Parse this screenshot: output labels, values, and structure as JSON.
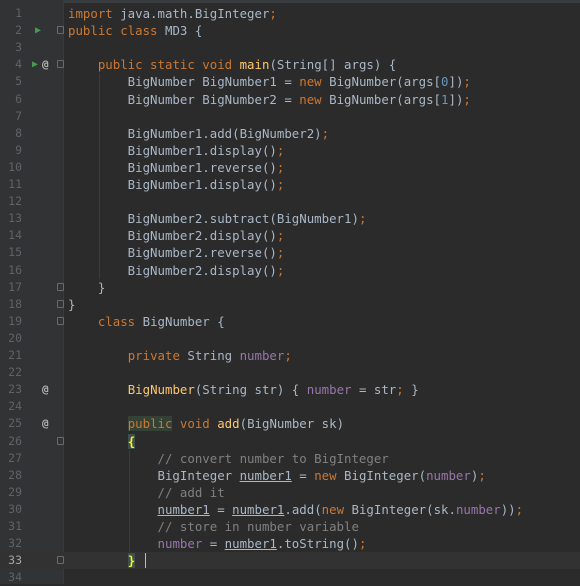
{
  "lines": [
    {
      "n": "1",
      "tokens": [
        [
          "kw",
          "import "
        ],
        [
          "p",
          "java.math.BigInteger"
        ],
        [
          "kw",
          ";"
        ]
      ]
    },
    {
      "n": "2",
      "tokens": [
        [
          "kw",
          "public class "
        ],
        [
          "p",
          "MD3 {"
        ]
      ]
    },
    {
      "n": "3",
      "tokens": []
    },
    {
      "n": "4",
      "tokens": [
        [
          "p",
          "    "
        ],
        [
          "kw",
          "public static void "
        ],
        [
          "fn",
          "main"
        ],
        [
          "p",
          "(String[] args) {"
        ]
      ]
    },
    {
      "n": "5",
      "tokens": [
        [
          "p",
          "        BigNumber BigNumber1 = "
        ],
        [
          "kw",
          "new "
        ],
        [
          "p",
          "BigNumber(args["
        ],
        [
          "num",
          "0"
        ],
        [
          "p",
          "])"
        ],
        [
          "kw",
          ";"
        ]
      ]
    },
    {
      "n": "6",
      "tokens": [
        [
          "p",
          "        BigNumber BigNumber2 = "
        ],
        [
          "kw",
          "new "
        ],
        [
          "p",
          "BigNumber(args["
        ],
        [
          "num",
          "1"
        ],
        [
          "p",
          "])"
        ],
        [
          "kw",
          ";"
        ]
      ]
    },
    {
      "n": "7",
      "tokens": []
    },
    {
      "n": "8",
      "tokens": [
        [
          "p",
          "        BigNumber1.add(BigNumber2)"
        ],
        [
          "kw",
          ";"
        ]
      ]
    },
    {
      "n": "9",
      "tokens": [
        [
          "p",
          "        BigNumber1.display()"
        ],
        [
          "kw",
          ";"
        ]
      ]
    },
    {
      "n": "10",
      "tokens": [
        [
          "p",
          "        BigNumber1.reverse()"
        ],
        [
          "kw",
          ";"
        ]
      ]
    },
    {
      "n": "11",
      "tokens": [
        [
          "p",
          "        BigNumber1.display()"
        ],
        [
          "kw",
          ";"
        ]
      ]
    },
    {
      "n": "12",
      "tokens": []
    },
    {
      "n": "13",
      "tokens": [
        [
          "p",
          "        BigNumber2.subtract(BigNumber1)"
        ],
        [
          "kw",
          ";"
        ]
      ]
    },
    {
      "n": "14",
      "tokens": [
        [
          "p",
          "        BigNumber2.display()"
        ],
        [
          "kw",
          ";"
        ]
      ]
    },
    {
      "n": "15",
      "tokens": [
        [
          "p",
          "        BigNumber2.reverse()"
        ],
        [
          "kw",
          ";"
        ]
      ]
    },
    {
      "n": "16",
      "tokens": [
        [
          "p",
          "        BigNumber2.display()"
        ],
        [
          "kw",
          ";"
        ]
      ]
    },
    {
      "n": "17",
      "tokens": [
        [
          "p",
          "    }"
        ]
      ]
    },
    {
      "n": "18",
      "tokens": [
        [
          "p",
          "}"
        ]
      ]
    },
    {
      "n": "19",
      "tokens": [
        [
          "p",
          "    "
        ],
        [
          "kw",
          "class "
        ],
        [
          "p",
          "BigNumber {"
        ]
      ]
    },
    {
      "n": "20",
      "tokens": []
    },
    {
      "n": "21",
      "tokens": [
        [
          "p",
          "        "
        ],
        [
          "kw",
          "private "
        ],
        [
          "p",
          "String "
        ],
        [
          "field",
          "number"
        ],
        [
          "kw",
          ";"
        ]
      ]
    },
    {
      "n": "22",
      "tokens": []
    },
    {
      "n": "23",
      "tokens": [
        [
          "p",
          "        "
        ],
        [
          "fn",
          "BigNumber"
        ],
        [
          "p",
          "(String str) { "
        ],
        [
          "field",
          "number "
        ],
        [
          "p",
          "= str"
        ],
        [
          "kw",
          "; "
        ],
        [
          "p",
          "}"
        ]
      ]
    },
    {
      "n": "24",
      "tokens": []
    },
    {
      "n": "25",
      "tokens": [
        [
          "p",
          "        "
        ],
        [
          "kw hl",
          "public"
        ],
        [
          "kw",
          " void "
        ],
        [
          "fn",
          "add"
        ],
        [
          "p",
          "(BigNumber sk)"
        ]
      ]
    },
    {
      "n": "26",
      "tokens": [
        [
          "p",
          "        "
        ],
        [
          "brace-hl",
          "{"
        ]
      ]
    },
    {
      "n": "27",
      "tokens": [
        [
          "cmt",
          "            // convert number to BigInteger"
        ]
      ]
    },
    {
      "n": "28",
      "tokens": [
        [
          "p",
          "            BigInteger "
        ],
        [
          "und",
          "number1"
        ],
        [
          "p",
          " = "
        ],
        [
          "kw",
          "new "
        ],
        [
          "p",
          "BigInteger("
        ],
        [
          "field",
          "number"
        ],
        [
          "p",
          ")"
        ],
        [
          "kw",
          ";"
        ]
      ]
    },
    {
      "n": "29",
      "tokens": [
        [
          "cmt",
          "            // add it"
        ]
      ]
    },
    {
      "n": "30",
      "tokens": [
        [
          "p",
          "            "
        ],
        [
          "und",
          "number1"
        ],
        [
          "p",
          " = "
        ],
        [
          "und",
          "number1"
        ],
        [
          "p",
          ".add("
        ],
        [
          "kw",
          "new "
        ],
        [
          "p",
          "BigInteger(sk."
        ],
        [
          "field",
          "number"
        ],
        [
          "p",
          "))"
        ],
        [
          "kw",
          ";"
        ]
      ]
    },
    {
      "n": "31",
      "tokens": [
        [
          "cmt",
          "            // store in number variable"
        ]
      ]
    },
    {
      "n": "32",
      "tokens": [
        [
          "p",
          "            "
        ],
        [
          "field",
          "number "
        ],
        [
          "p",
          "= "
        ],
        [
          "und",
          "number1"
        ],
        [
          "p",
          ".toString()"
        ],
        [
          "kw",
          ";"
        ]
      ]
    },
    {
      "n": "33",
      "tokens": [
        [
          "p",
          "        "
        ],
        [
          "brace-hl",
          "}"
        ]
      ]
    },
    {
      "n": "34",
      "tokens": []
    }
  ],
  "gutter_icons": {
    "2": [
      "run"
    ],
    "4": [
      "run",
      "at"
    ],
    "23": [
      "at"
    ],
    "25": [
      "at"
    ]
  },
  "fold_markers": [
    "2",
    "4",
    "17",
    "18",
    "19",
    "26",
    "33"
  ],
  "current_line": "33",
  "colors": {
    "background": "#2b2b2b",
    "gutter": "#313335",
    "keyword": "#cc7832",
    "method": "#ffc66d",
    "number": "#6897bb",
    "field": "#9876aa",
    "comment": "#808080",
    "text": "#a9b7c6"
  }
}
